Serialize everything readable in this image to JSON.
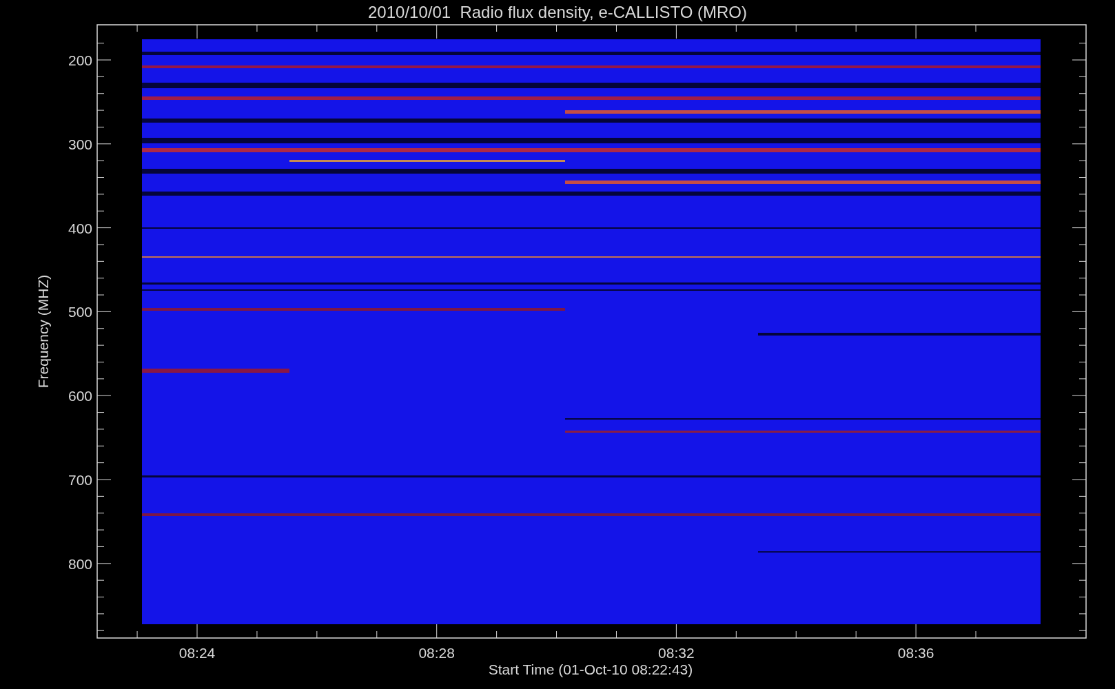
{
  "title": "2010/10/01  Radio flux density, e-CALLISTO (MRO)",
  "y_axis": {
    "label": "Frequency (MHZ)",
    "ticks": [
      "200",
      "300",
      "400",
      "500",
      "600",
      "700",
      "800"
    ]
  },
  "x_axis": {
    "label": "Start Time (01-Oct-10 08:22:43)",
    "ticks": [
      "08:24",
      "08:28",
      "08:32",
      "08:36"
    ]
  }
}
